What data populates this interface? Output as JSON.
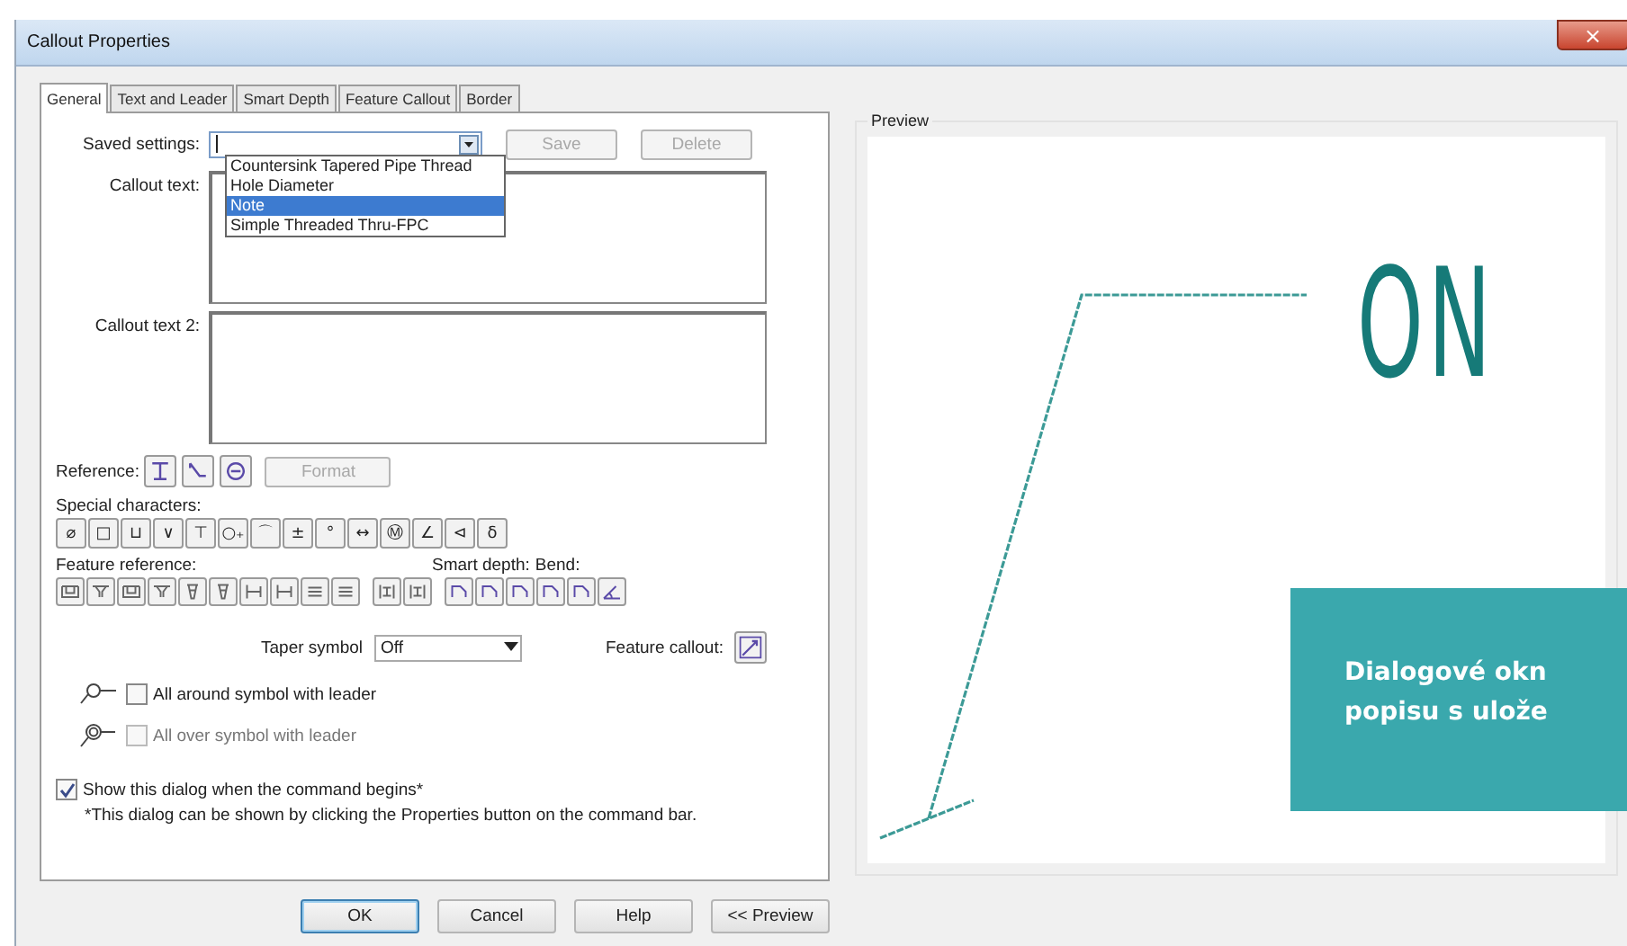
{
  "window": {
    "title": "Callout Properties",
    "close": "×"
  },
  "tabs": [
    {
      "label": "General",
      "selected": true
    },
    {
      "label": "Text and Leader",
      "selected": false
    },
    {
      "label": "Smart Depth",
      "selected": false
    },
    {
      "label": "Feature Callout",
      "selected": false
    },
    {
      "label": "Border",
      "selected": false
    }
  ],
  "saved_settings": {
    "label": "Saved settings:",
    "expanded": true,
    "options": [
      {
        "label": "Countersink Tapered Pipe Thread",
        "selected": false
      },
      {
        "label": "Hole Diameter",
        "selected": false
      },
      {
        "label": "Note",
        "selected": true
      },
      {
        "label": "Simple Threaded Thru-FPC",
        "selected": false
      }
    ]
  },
  "save_button": {
    "label": "Save",
    "disabled": true
  },
  "delete_button": {
    "label": "Delete",
    "disabled": true
  },
  "callout_text": {
    "label": "Callout text:"
  },
  "callout_text_2": {
    "label": "Callout text 2:"
  },
  "reference": {
    "label": "Reference:",
    "buttons": [
      {
        "kind": "text"
      },
      {
        "kind": "leader"
      },
      {
        "kind": "balloon"
      }
    ],
    "format_button": {
      "label": "Format",
      "disabled": true
    }
  },
  "special_characters": {
    "label": "Special characters:",
    "buttons": [
      "⌀",
      "□",
      "⊔",
      "∨",
      "⊤",
      "○₊",
      "⌒",
      "±",
      "°",
      "↔",
      "Ⓜ",
      "∠",
      "⊲",
      "δ"
    ]
  },
  "feature_reference": {
    "label": "Feature reference:",
    "buttons": [
      {
        "kind": "counterbore"
      },
      {
        "kind": "countersink"
      },
      {
        "kind": "counterbore"
      },
      {
        "kind": "countersink"
      },
      {
        "kind": "taper"
      },
      {
        "kind": "taper"
      },
      {
        "kind": "slot"
      },
      {
        "kind": "slot"
      },
      {
        "kind": "lines"
      },
      {
        "kind": "lines"
      }
    ]
  },
  "smart_depth": {
    "label": "Smart depth:",
    "buttons": [
      {
        "kind": "depth"
      },
      {
        "kind": "depth"
      }
    ]
  },
  "bend": {
    "label": "Bend:",
    "buttons": [
      {
        "kind": "bend"
      },
      {
        "kind": "bend"
      },
      {
        "kind": "bend"
      },
      {
        "kind": "bend"
      },
      {
        "kind": "bend"
      },
      {
        "kind": "angle"
      }
    ]
  },
  "taper_symbol": {
    "label": "Taper symbol",
    "value": "Off"
  },
  "feature_callout": {
    "label": "Feature callout:"
  },
  "options": [
    {
      "kind": "around",
      "label": "All around symbol with leader",
      "checked": false,
      "disabled": false
    },
    {
      "kind": "over",
      "label": "All over symbol with leader",
      "checked": false,
      "disabled": true
    },
    {
      "kind": "plain",
      "label": "Show this dialog when the command begins*",
      "checked": true,
      "disabled": false
    }
  ],
  "footnote": "*This dialog can be shown by clicking the Properties button on the command bar.",
  "buttons": [
    {
      "label": "OK",
      "default": true
    },
    {
      "label": "Cancel",
      "default": false
    },
    {
      "label": "Help",
      "default": false
    },
    {
      "label": "<< Preview",
      "default": false
    }
  ],
  "preview": {
    "label": "Preview",
    "callout_text": "ON"
  },
  "overlay": {
    "lines": [
      "Dialogové okn",
      "popisu s ulože"
    ]
  }
}
